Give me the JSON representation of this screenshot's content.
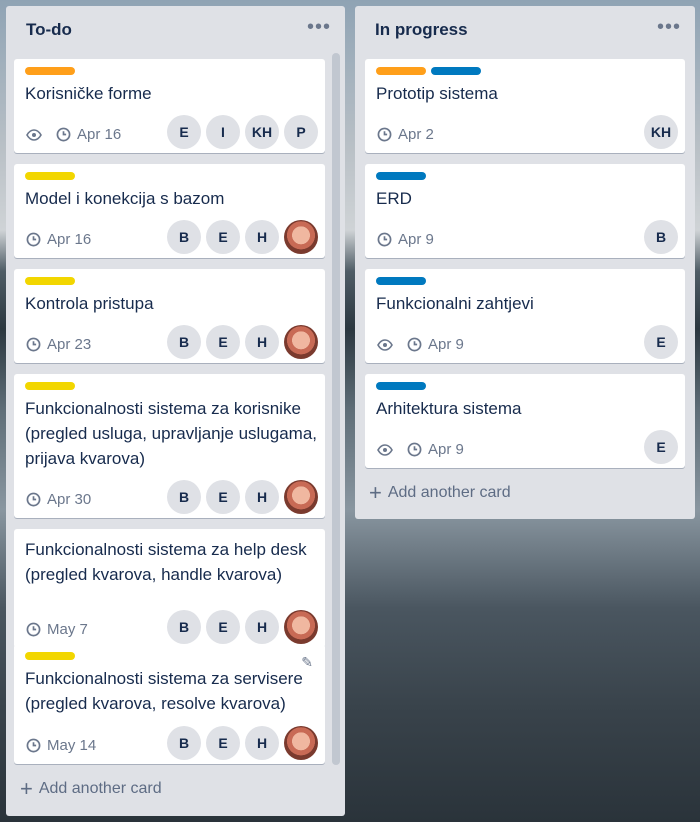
{
  "colors": {
    "orange": "#ff9f1a",
    "yellow": "#f2d600",
    "blue": "#0079bf"
  },
  "lists": [
    {
      "title": "To-do",
      "add_card": "Add another card",
      "cards": [
        {
          "labels": [
            "orange"
          ],
          "title": "Korisničke forme",
          "watch": true,
          "due": "Apr 16",
          "members": [
            "E",
            "I",
            "KH",
            "P"
          ]
        },
        {
          "labels": [
            "yellow"
          ],
          "title": "Model i konekcija s bazom",
          "watch": false,
          "due": "Apr 16",
          "members": [
            "B",
            "E",
            "H",
            "photo"
          ]
        },
        {
          "labels": [
            "yellow"
          ],
          "title": "Kontrola pristupa",
          "watch": false,
          "due": "Apr 23",
          "members": [
            "B",
            "E",
            "H",
            "photo"
          ]
        },
        {
          "labels": [
            "yellow"
          ],
          "title": "Funkcionalnosti sistema za korisnike (pregled usluga, upravljanje uslugama, prijava kvarova)",
          "watch": false,
          "due": "Apr 30",
          "members": [
            "B",
            "E",
            "H",
            "photo"
          ]
        },
        {
          "labels": [],
          "title": "Funkcionalnosti sistema za help desk (pregled kvarova, handle kvarova)",
          "watch": false,
          "due": "May 7",
          "members": [
            "B",
            "E",
            "H",
            "photo"
          ]
        },
        {
          "labels": [
            "yellow"
          ],
          "title": "Funkcionalnosti sistema za servisere (pregled kvarova, resolve kvarova)",
          "watch": false,
          "due": "May 14",
          "members": [
            "B",
            "E",
            "H",
            "photo"
          ]
        }
      ]
    },
    {
      "title": "In progress",
      "add_card": "Add another card",
      "cards": [
        {
          "labels": [
            "orange",
            "blue"
          ],
          "title": "Prototip sistema",
          "watch": false,
          "due": "Apr 2",
          "members": [
            "KH"
          ]
        },
        {
          "labels": [
            "blue"
          ],
          "title": "ERD",
          "watch": false,
          "due": "Apr 9",
          "members": [
            "B"
          ]
        },
        {
          "labels": [
            "blue"
          ],
          "title": "Funkcionalni zahtjevi",
          "watch": true,
          "due": "Apr 9",
          "members": [
            "E"
          ]
        },
        {
          "labels": [
            "blue"
          ],
          "title": "Arhitektura sistema",
          "watch": true,
          "due": "Apr 9",
          "members": [
            "E"
          ]
        }
      ]
    }
  ]
}
